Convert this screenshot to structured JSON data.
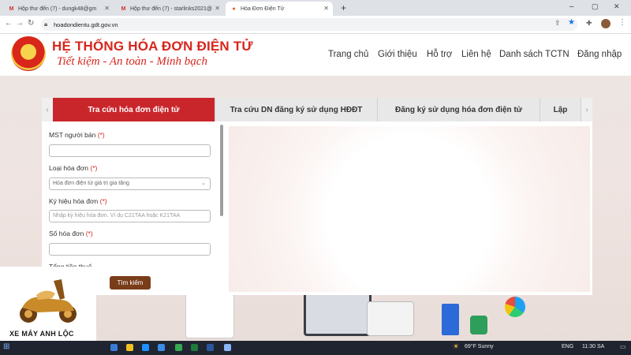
{
  "browser": {
    "tabs": [
      {
        "label": "Hộp thư đến (7) - dungk48@gm",
        "icon": "gmail-icon"
      },
      {
        "label": "Hộp thư đến (7) - starlinks2021@",
        "icon": "gmail-icon"
      },
      {
        "label": "Hóa Đơn Điện Tử",
        "icon": "site-icon",
        "active": true
      }
    ],
    "new_tab": "+",
    "url": "hoadondientu.gdt.gov.vn"
  },
  "site": {
    "title": "HỆ THỐNG HÓA ĐƠN ĐIỆN TỬ",
    "slogan": "Tiết kiệm - An toàn - Minh bạch",
    "menu": [
      "Trang chủ",
      "Giới thiệu",
      "Hỗ trợ",
      "Liên hệ",
      "Danh sách TCTN",
      "Đăng nhập"
    ]
  },
  "search": {
    "tabs": [
      {
        "label": "Tra cứu hóa đơn điện tử",
        "active": true
      },
      {
        "label": "Tra cứu DN đăng ký sử dụng HĐĐT"
      },
      {
        "label": "Đăng ký sử dụng hóa đơn điện tử"
      },
      {
        "label": "Lập"
      }
    ],
    "fields": {
      "mst_label": "MST người bán",
      "type_label": "Loại hóa đơn",
      "type_value": "Hóa đơn điện tử giá trị gia tăng",
      "symbol_label": "Ký hiệu hóa đơn",
      "symbol_placeholder": "Nhập ký hiệu hóa đơn. Ví dụ C21TAA hoặc K21TAA",
      "number_label": "Số hóa đơn",
      "tax_label": "Tổng tiền thuế",
      "required_mark": "(*)"
    },
    "search_button": "Tìm kiếm"
  },
  "watermark": {
    "text": "XE MÁY ANH LỘC"
  },
  "taskbar": {
    "weather": "69°F  Sunny",
    "language": "ENG",
    "time": "11:30 SA"
  },
  "colors": {
    "accent": "#c9262c",
    "title_red": "#d7261d",
    "button_brown": "#7a3d1a"
  }
}
